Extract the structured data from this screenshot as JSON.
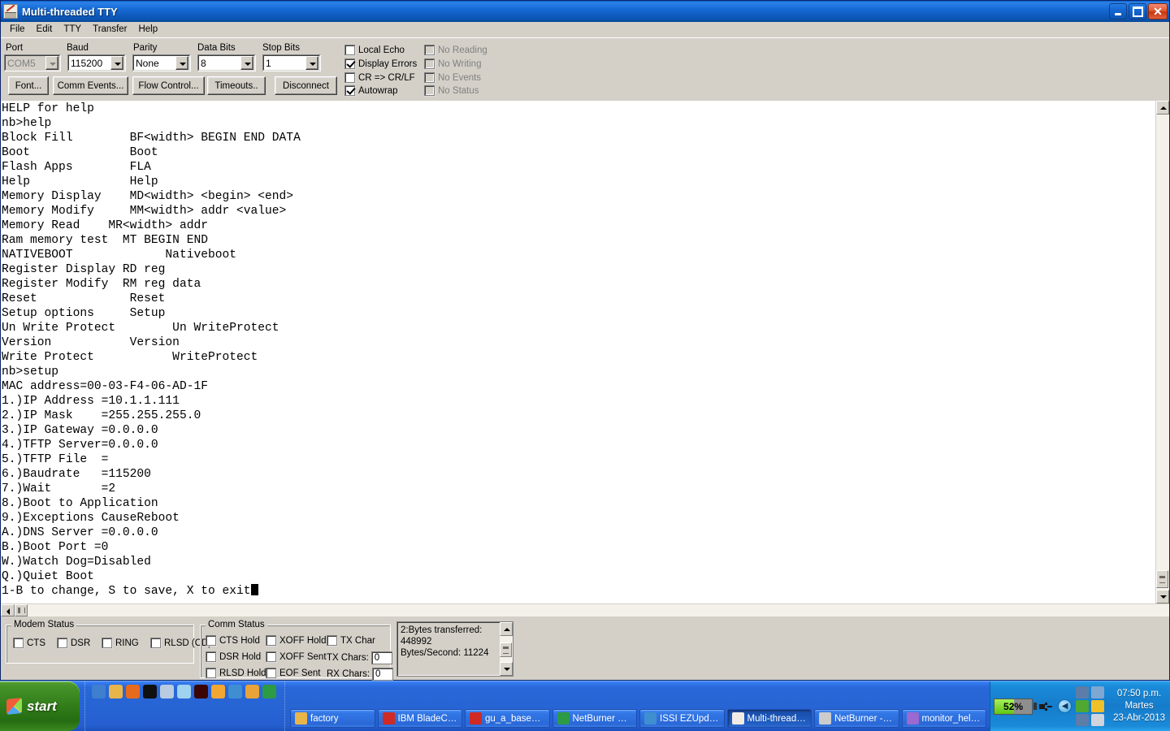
{
  "window": {
    "title": "Multi-threaded TTY",
    "icon": "tty-app-icon",
    "caption_buttons": {
      "minimize": "minimize-button",
      "maximize": "restore-button",
      "close": "✕"
    }
  },
  "menu": {
    "items": [
      {
        "label": "File",
        "name": "menu-file"
      },
      {
        "label": "Edit",
        "name": "menu-edit"
      },
      {
        "label": "TTY",
        "name": "menu-tty"
      },
      {
        "label": "Transfer",
        "name": "menu-transfer"
      },
      {
        "label": "Help",
        "name": "menu-help"
      }
    ]
  },
  "toolbar": {
    "labels": {
      "port": "Port",
      "baud": "Baud",
      "parity": "Parity",
      "data_bits": "Data Bits",
      "stop_bits": "Stop Bits"
    },
    "combos": {
      "port": {
        "value": "COM5",
        "disabled": true
      },
      "baud": {
        "value": "115200",
        "disabled": false
      },
      "parity": {
        "value": "None",
        "disabled": false
      },
      "data_bits": {
        "value": "8",
        "disabled": false
      },
      "stop_bits": {
        "value": "1",
        "disabled": false
      }
    },
    "buttons": {
      "font": "Font...",
      "comm_events": "Comm Events...",
      "flow_control": "Flow Control...",
      "timeouts": "Timeouts..",
      "disconnect": "Disconnect"
    },
    "checkboxes_left": [
      {
        "label": "Local Echo",
        "checked": false,
        "disabled": false,
        "name": "checkbox-local-echo"
      },
      {
        "label": "Display Errors",
        "checked": true,
        "disabled": false,
        "name": "checkbox-display-errors"
      },
      {
        "label": "CR => CR/LF",
        "checked": false,
        "disabled": false,
        "name": "checkbox-cr-crlf"
      },
      {
        "label": "Autowrap",
        "checked": true,
        "disabled": false,
        "name": "checkbox-autowrap"
      }
    ],
    "checkboxes_right": [
      {
        "label": "No Reading",
        "checked": false,
        "disabled": true,
        "name": "checkbox-no-reading"
      },
      {
        "label": "No Writing",
        "checked": false,
        "disabled": true,
        "name": "checkbox-no-writing"
      },
      {
        "label": "No Events",
        "checked": false,
        "disabled": true,
        "name": "checkbox-no-events"
      },
      {
        "label": "No Status",
        "checked": false,
        "disabled": true,
        "name": "checkbox-no-status"
      }
    ]
  },
  "terminal": {
    "lines": [
      "HELP for help",
      "nb>help",
      "Block Fill        BF<width> BEGIN END DATA",
      "Boot              Boot",
      "Flash Apps        FLA",
      "Help              Help",
      "Memory Display    MD<width> <begin> <end>",
      "Memory Modify     MM<width> addr <value>",
      "Memory Read    MR<width> addr",
      "Ram memory test  MT BEGIN END",
      "NATIVEBOOT             Nativeboot",
      "Register Display RD reg",
      "Register Modify  RM reg data",
      "Reset             Reset",
      "Setup options     Setup",
      "Un Write Protect        Un WriteProtect",
      "Version           Version",
      "Write Protect           WriteProtect",
      "nb>setup",
      "MAC address=00-03-F4-06-AD-1F",
      "1.)IP Address =10.1.1.111",
      "2.)IP Mask    =255.255.255.0",
      "3.)IP Gateway =0.0.0.0",
      "4.)TFTP Server=0.0.0.0",
      "5.)TFTP File  =",
      "6.)Baudrate   =115200",
      "7.)Wait       =2",
      "8.)Boot to Application",
      "9.)Exceptions CauseReboot",
      "A.)DNS Server =0.0.0.0",
      "B.)Boot Port =0",
      "W.)Watch Dog=Disabled",
      "Q.)Quiet Boot"
    ],
    "last_line": "1-B to change, S to save, X to exit"
  },
  "status": {
    "modem": {
      "title": "Modem Status",
      "items": [
        {
          "label": "CTS",
          "checked": false,
          "name": "checkbox-cts"
        },
        {
          "label": "DSR",
          "checked": false,
          "name": "checkbox-dsr"
        },
        {
          "label": "RING",
          "checked": false,
          "name": "checkbox-ring"
        },
        {
          "label": "RLSD (CD)",
          "checked": false,
          "name": "checkbox-rlsd-cd"
        }
      ]
    },
    "comm": {
      "title": "Comm Status",
      "col1": [
        {
          "label": "CTS Hold",
          "checked": false,
          "name": "checkbox-cts-hold"
        },
        {
          "label": "DSR Hold",
          "checked": false,
          "name": "checkbox-dsr-hold"
        },
        {
          "label": "RLSD Hold",
          "checked": false,
          "name": "checkbox-rlsd-hold"
        }
      ],
      "col2": [
        {
          "label": "XOFF Hold",
          "checked": false,
          "name": "checkbox-xoff-hold"
        },
        {
          "label": "XOFF Sent",
          "checked": false,
          "name": "checkbox-xoff-sent"
        },
        {
          "label": "EOF Sent",
          "checked": false,
          "name": "checkbox-eof-sent"
        }
      ],
      "tx_char_label": "TX Char",
      "tx_chars_label": "TX Chars:",
      "tx_chars_value": "0",
      "rx_chars_label": "RX Chars:",
      "rx_chars_value": "0"
    },
    "transfer_panel": {
      "line1": "2:Bytes transferred:",
      "line2": "448992",
      "line3": "Bytes/Second: 11224"
    }
  },
  "taskbar": {
    "start_label": "start",
    "quick_launch": [
      {
        "name": "quicklaunch-show-desktop-icon",
        "color": "#3f7fd0"
      },
      {
        "name": "quicklaunch-folder-icon",
        "color": "#e8b54a"
      },
      {
        "name": "quicklaunch-firefox-icon",
        "color": "#e86a1c"
      },
      {
        "name": "quicklaunch-command-prompt-icon",
        "color": "#101010"
      },
      {
        "name": "quicklaunch-notepad-icon",
        "color": "#b9cbe0"
      },
      {
        "name": "quicklaunch-document-icon",
        "color": "#9fd2f0"
      },
      {
        "name": "quicklaunch-stop-icon",
        "color": "#3b0505"
      },
      {
        "name": "quicklaunch-messenger-icon",
        "color": "#f3a733"
      },
      {
        "name": "quicklaunch-excel-icon",
        "color": "#3f8fd0"
      },
      {
        "name": "quicklaunch-crown-icon",
        "color": "#e8a33a"
      },
      {
        "name": "quicklaunch-chrome-icon",
        "color": "#2d9a46"
      }
    ],
    "tasks": [
      {
        "label": "factory",
        "icon": "folder-icon",
        "active": false,
        "name": "taskbar-item-factory"
      },
      {
        "label": "IBM BladeCente...",
        "icon": "pdf-icon",
        "active": false,
        "name": "taskbar-item-ibm-bladecenter"
      },
      {
        "label": "gu_a_bases_de...",
        "icon": "pdf-icon",
        "active": false,
        "name": "taskbar-item-gu-a-bases-de"
      },
      {
        "label": "NetBurner Com...",
        "icon": "chrome-icon",
        "active": false,
        "name": "taskbar-item-netburner-com"
      },
      {
        "label": "ISSI EZUpdate",
        "icon": "ezupdate-icon",
        "active": false,
        "name": "taskbar-item-issi-ezupdate"
      },
      {
        "label": "Multi-threaded TTY",
        "icon": "tty-app-icon",
        "active": true,
        "name": "taskbar-item-multi-threaded-tty"
      },
      {
        "label": "NetBurner - NBE...",
        "icon": "netburner-icon",
        "active": false,
        "name": "taskbar-item-netburner-nbe"
      },
      {
        "label": "monitor_help.JP...",
        "icon": "image-icon",
        "active": false,
        "name": "taskbar-item-monitor-help-jpg"
      }
    ],
    "battery_percent": "52%",
    "tray_icons": [
      {
        "name": "network-warning-icon"
      },
      {
        "name": "wireless-icon"
      },
      {
        "name": "volume-icon"
      },
      {
        "name": "update-icon"
      },
      {
        "name": "network-computers-icon"
      },
      {
        "name": "antivirus-icon"
      }
    ],
    "clock": {
      "time": "07:50 p.m.",
      "day": "Martes",
      "date": "23-Abr-2013"
    }
  }
}
